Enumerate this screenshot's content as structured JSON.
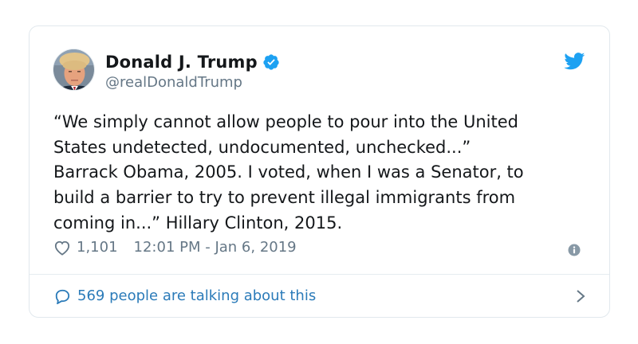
{
  "tweet": {
    "author": {
      "display_name": "Donald J. Trump",
      "handle": "@realDonaldTrump",
      "verified": true
    },
    "text": "“We simply cannot allow people to pour into the United\nStates undetected, undocumented, unchecked...”\nBarrack Obama, 2005. I voted, when I was a Senator, to\nbuild a barrier to try to prevent illegal immigrants from\ncoming in...” Hillary Clinton, 2015.",
    "likes": "1,101",
    "timestamp": "12:01 PM - Jan 6, 2019",
    "conversation_label": "569 people are talking about this"
  },
  "icons": {
    "brand": "twitter-bird-icon",
    "verified": "verified-badge-icon",
    "like": "heart-icon",
    "info": "info-icon",
    "reply": "speech-bubble-icon",
    "chevron": "chevron-right-icon"
  },
  "colors": {
    "accent": "#1da1f2",
    "link": "#2b7bb9",
    "secondary_text": "#657786",
    "border": "#e1e8ed"
  }
}
